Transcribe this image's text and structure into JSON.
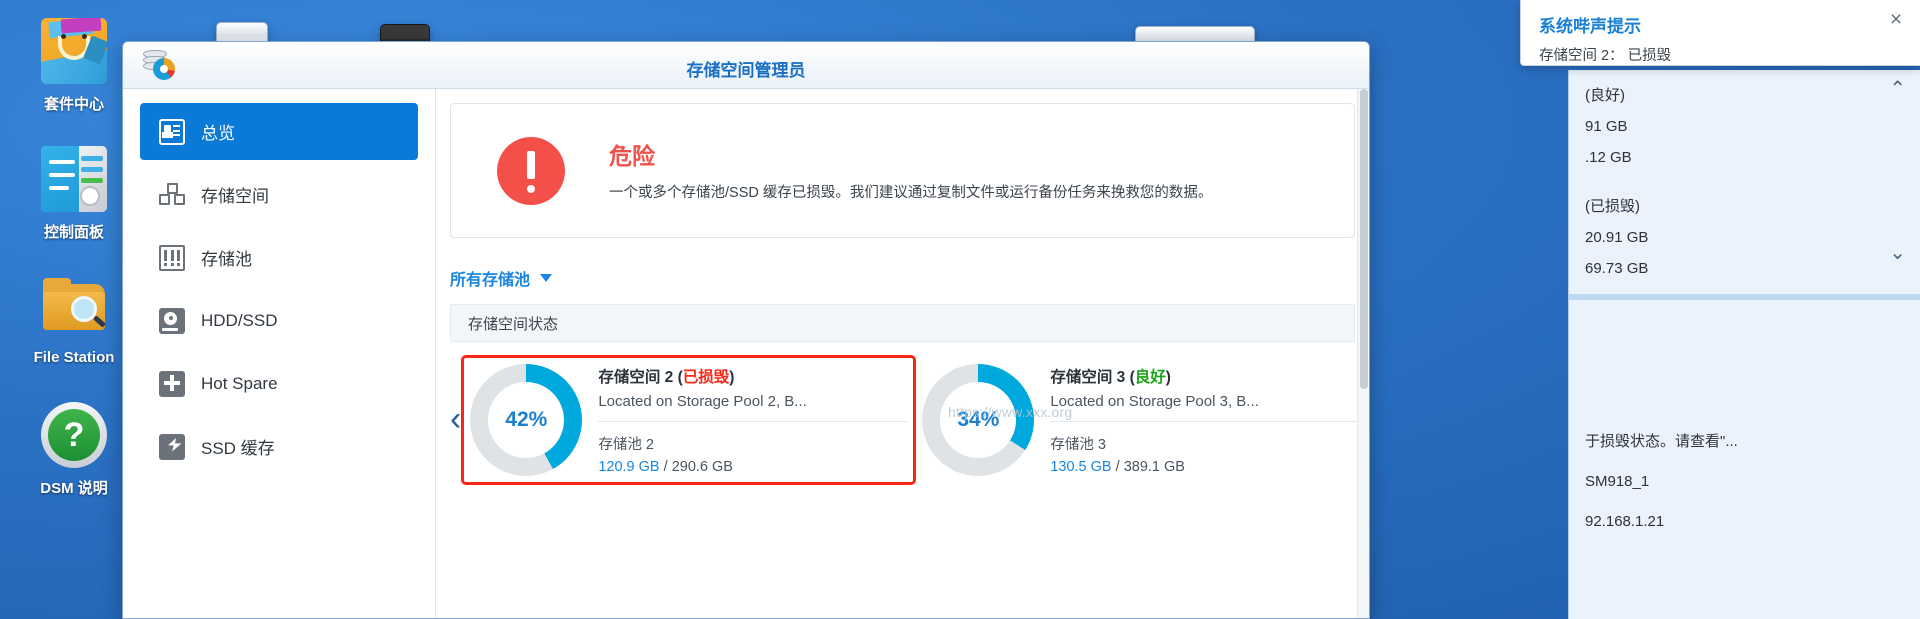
{
  "desktop": {
    "icons": [
      {
        "label": "套件中心",
        "icon": "package-center-icon"
      },
      {
        "label": "控制面板",
        "icon": "control-panel-icon"
      },
      {
        "label": "File Station",
        "icon": "file-station-icon"
      },
      {
        "label": "DSM 说明",
        "icon": "dsm-help-icon"
      }
    ]
  },
  "window": {
    "title": "存储空间管理员",
    "app_icon": "storage-manager-icon"
  },
  "sidebar": {
    "items": [
      {
        "label": "总览",
        "icon": "overview-icon",
        "active": true
      },
      {
        "label": "存储空间",
        "icon": "volume-icon",
        "active": false
      },
      {
        "label": "存储池",
        "icon": "storage-pool-icon",
        "active": false
      },
      {
        "label": "HDD/SSD",
        "icon": "hdd-ssd-icon",
        "active": false
      },
      {
        "label": "Hot Spare",
        "icon": "hot-spare-icon",
        "active": false
      },
      {
        "label": "SSD 缓存",
        "icon": "ssd-cache-icon",
        "active": false
      }
    ]
  },
  "alert": {
    "icon": "danger-exclamation-icon",
    "title": "危险",
    "description": "一个或多个存储池/SSD 缓存已损毁。我们建议通过复制文件或运行备份任务来挽救您的数据。",
    "title_color": "#f4504a"
  },
  "filter": {
    "label": "所有存储池",
    "caret": "chevron-down-icon"
  },
  "section": {
    "title": "存储空间状态"
  },
  "watermark": "https://www.xxx.org",
  "nav": {
    "prev": "‹",
    "next": "›"
  },
  "cards": [
    {
      "title_name": "存储空间 2",
      "status": "已损毁",
      "status_color": "#f72718",
      "subtitle": "Located on Storage Pool 2, B...",
      "pool": "存储池 2",
      "used": "120.9 GB",
      "total": "290.6 GB",
      "percent": "42%",
      "percent_value": 42,
      "highlighted": true
    },
    {
      "title_name": "存储空间 3",
      "status": "良好",
      "status_color": "#17a517",
      "subtitle": "Located on Storage Pool 3, B...",
      "pool": "存储池 3",
      "used": "130.5 GB",
      "total": "389.1 GB",
      "percent": "34%",
      "percent_value": 34,
      "highlighted": false
    }
  ],
  "right_panel": {
    "block1": {
      "line1": "(良好)",
      "line2": "91 GB",
      "line3": ".12 GB",
      "line4": "(已损毁)",
      "line5": "20.91 GB",
      "line6": "69.73 GB",
      "chevron_up": "chevron-up-icon",
      "chevron_down": "chevron-down-icon"
    },
    "block2": {
      "line1": "于损毁状态。请查看\"...",
      "line2": "SM918_1",
      "line3": "92.168.1.21"
    }
  },
  "toast": {
    "title": "系统哔声提示",
    "message": "存储空间 2：  已损毁",
    "close": "close-icon"
  },
  "colors": {
    "accent": "#0b7ad6",
    "danger": "#f72718",
    "good": "#17a517",
    "donut_fill": "#00a9dd",
    "donut_track": "#dfe3e6",
    "desktop_bg": "#2874c8"
  }
}
